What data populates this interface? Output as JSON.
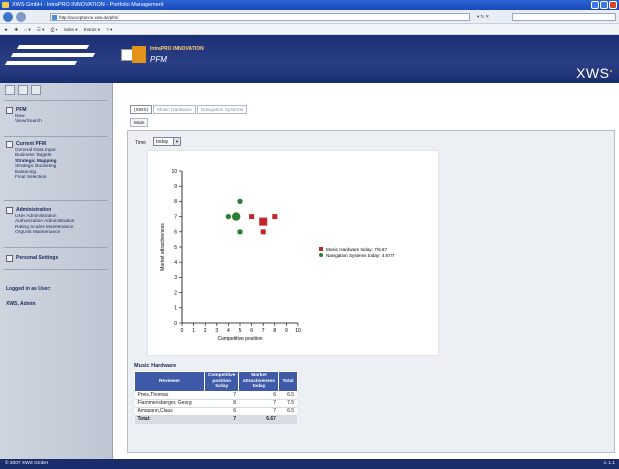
{
  "window": {
    "title": "XWS GmbH - IntraPRO INNOVATION - Portfolio Management",
    "url": "http://acceptance.xws.de/pfm/",
    "cmd_items": [
      "Seite ▾",
      "Extras ▾"
    ]
  },
  "header": {
    "app_name": "IntraPRO INNOVATION",
    "app_sub": "PFM",
    "brand": "XWS"
  },
  "sidebar": {
    "pfm": {
      "title": "PFM",
      "items": [
        "New",
        "View/Search"
      ]
    },
    "current": {
      "title": "Current PFM",
      "items": [
        "General Data Input",
        "Business Targets",
        "Strategic Mapping",
        "Strategic Bucketing",
        "Balancing",
        "Final Selection"
      ],
      "active_index": 2
    },
    "admin": {
      "title": "Administration",
      "items": [
        "User Administration",
        "Authorization Administration",
        "Rating Scales Maintenance",
        "OrgUnit Maintenance"
      ]
    },
    "personal": {
      "title": "Personal Settings"
    },
    "logged_label": "Logged in as User:",
    "logged_user": "XWS, Admin"
  },
  "main": {
    "tabs": [
      {
        "label": "(XWS)",
        "active": true
      },
      {
        "label": "Music Hardware",
        "active": false
      },
      {
        "label": "Navigation Systems",
        "active": false
      }
    ],
    "subtab": "Main",
    "time_label": "Time",
    "time_value": "today"
  },
  "chart_data": {
    "type": "scatter",
    "xlabel": "Competitive position",
    "ylabel": "Market attractiveness",
    "xlim": [
      0,
      10
    ],
    "ylim": [
      0,
      10
    ],
    "xticks": [
      0,
      1,
      2,
      3,
      4,
      5,
      6,
      7,
      8,
      9,
      10
    ],
    "yticks": [
      0,
      1,
      2,
      3,
      4,
      5,
      6,
      7,
      8,
      9,
      10
    ],
    "legend_position": "right",
    "series": [
      {
        "name": "Music Hardware today: 7/6.67",
        "marker": "square",
        "color": "#c0282d",
        "points": [
          [
            6,
            7
          ],
          [
            7,
            6
          ],
          [
            8,
            7
          ]
        ],
        "aggregate": [
          7,
          6.67
        ]
      },
      {
        "name": "Navigation Systems today: 4.67/7",
        "marker": "circle",
        "color": "#2e7d32",
        "points": [
          [
            4,
            7
          ],
          [
            5,
            8
          ],
          [
            5,
            6
          ]
        ],
        "aggregate": [
          4.67,
          7
        ]
      }
    ]
  },
  "table": {
    "title": "Music Hardware",
    "headers": [
      "Reviewer",
      "Competitive position today",
      "Market attractiveness today",
      "Total"
    ],
    "rows": [
      [
        "Preis,Thomas",
        "7",
        "6",
        "6.5"
      ],
      [
        "Flammensberger, Georg",
        "8",
        "7",
        "7.5"
      ],
      [
        "Amspann,Claus",
        "6",
        "7",
        "6.5"
      ]
    ],
    "total": [
      "Total:",
      "7",
      "6.67",
      ""
    ]
  },
  "status": {
    "copyright": "© 2007 XWS GmbH",
    "version": "v. 1.1"
  }
}
